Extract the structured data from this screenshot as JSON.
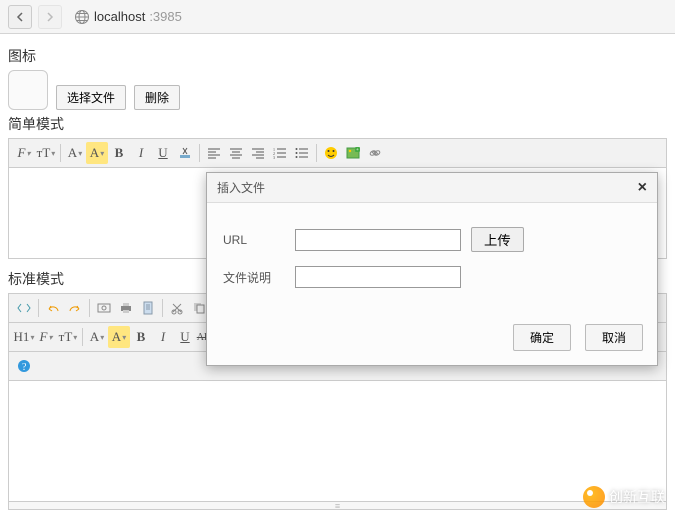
{
  "browser": {
    "host": "localhost",
    "port": ":3985"
  },
  "labels": {
    "icon_section": "图标",
    "choose_file": "选择文件",
    "delete": "删除",
    "simple_mode": "简单模式",
    "standard_mode": "标准模式"
  },
  "dialog": {
    "title": "插入文件",
    "url_label": "URL",
    "url_value": "",
    "upload": "上传",
    "desc_label": "文件说明",
    "desc_value": "",
    "ok": "确定",
    "cancel": "取消"
  },
  "watermark": "创新互联",
  "toolbar_simple": {
    "F": "F",
    "tT": "тT",
    "A": "A",
    "A_hl": "A",
    "B": "B",
    "I": "I",
    "U": "U"
  },
  "toolbar_std": {
    "H1": "H1",
    "F": "F",
    "tT": "тT",
    "A": "A",
    "A_hl": "A",
    "B": "B",
    "I": "I",
    "U": "U",
    "ABC": "ABC"
  }
}
